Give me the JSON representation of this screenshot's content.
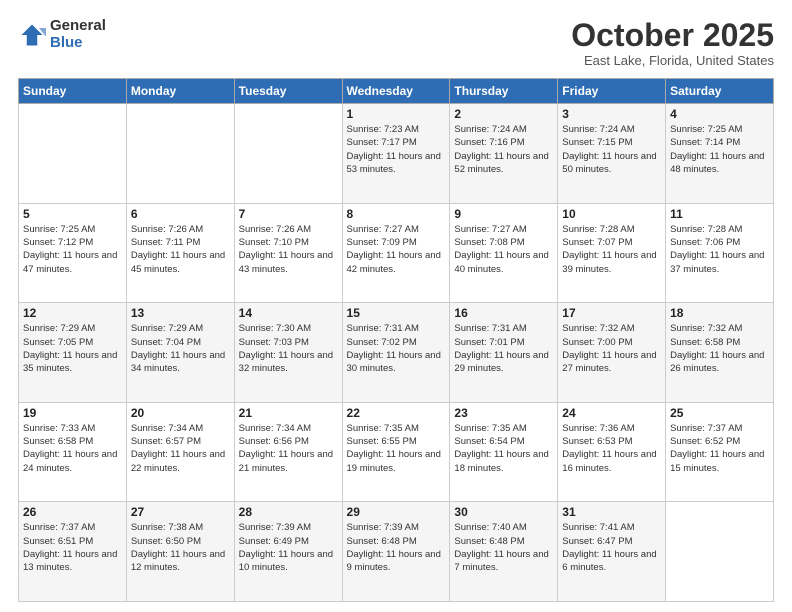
{
  "logo": {
    "general": "General",
    "blue": "Blue"
  },
  "title": "October 2025",
  "location": "East Lake, Florida, United States",
  "days_of_week": [
    "Sunday",
    "Monday",
    "Tuesday",
    "Wednesday",
    "Thursday",
    "Friday",
    "Saturday"
  ],
  "weeks": [
    [
      {
        "day": "",
        "info": ""
      },
      {
        "day": "",
        "info": ""
      },
      {
        "day": "",
        "info": ""
      },
      {
        "day": "1",
        "info": "Sunrise: 7:23 AM\nSunset: 7:17 PM\nDaylight: 11 hours and 53 minutes."
      },
      {
        "day": "2",
        "info": "Sunrise: 7:24 AM\nSunset: 7:16 PM\nDaylight: 11 hours and 52 minutes."
      },
      {
        "day": "3",
        "info": "Sunrise: 7:24 AM\nSunset: 7:15 PM\nDaylight: 11 hours and 50 minutes."
      },
      {
        "day": "4",
        "info": "Sunrise: 7:25 AM\nSunset: 7:14 PM\nDaylight: 11 hours and 48 minutes."
      }
    ],
    [
      {
        "day": "5",
        "info": "Sunrise: 7:25 AM\nSunset: 7:12 PM\nDaylight: 11 hours and 47 minutes."
      },
      {
        "day": "6",
        "info": "Sunrise: 7:26 AM\nSunset: 7:11 PM\nDaylight: 11 hours and 45 minutes."
      },
      {
        "day": "7",
        "info": "Sunrise: 7:26 AM\nSunset: 7:10 PM\nDaylight: 11 hours and 43 minutes."
      },
      {
        "day": "8",
        "info": "Sunrise: 7:27 AM\nSunset: 7:09 PM\nDaylight: 11 hours and 42 minutes."
      },
      {
        "day": "9",
        "info": "Sunrise: 7:27 AM\nSunset: 7:08 PM\nDaylight: 11 hours and 40 minutes."
      },
      {
        "day": "10",
        "info": "Sunrise: 7:28 AM\nSunset: 7:07 PM\nDaylight: 11 hours and 39 minutes."
      },
      {
        "day": "11",
        "info": "Sunrise: 7:28 AM\nSunset: 7:06 PM\nDaylight: 11 hours and 37 minutes."
      }
    ],
    [
      {
        "day": "12",
        "info": "Sunrise: 7:29 AM\nSunset: 7:05 PM\nDaylight: 11 hours and 35 minutes."
      },
      {
        "day": "13",
        "info": "Sunrise: 7:29 AM\nSunset: 7:04 PM\nDaylight: 11 hours and 34 minutes."
      },
      {
        "day": "14",
        "info": "Sunrise: 7:30 AM\nSunset: 7:03 PM\nDaylight: 11 hours and 32 minutes."
      },
      {
        "day": "15",
        "info": "Sunrise: 7:31 AM\nSunset: 7:02 PM\nDaylight: 11 hours and 30 minutes."
      },
      {
        "day": "16",
        "info": "Sunrise: 7:31 AM\nSunset: 7:01 PM\nDaylight: 11 hours and 29 minutes."
      },
      {
        "day": "17",
        "info": "Sunrise: 7:32 AM\nSunset: 7:00 PM\nDaylight: 11 hours and 27 minutes."
      },
      {
        "day": "18",
        "info": "Sunrise: 7:32 AM\nSunset: 6:58 PM\nDaylight: 11 hours and 26 minutes."
      }
    ],
    [
      {
        "day": "19",
        "info": "Sunrise: 7:33 AM\nSunset: 6:58 PM\nDaylight: 11 hours and 24 minutes."
      },
      {
        "day": "20",
        "info": "Sunrise: 7:34 AM\nSunset: 6:57 PM\nDaylight: 11 hours and 22 minutes."
      },
      {
        "day": "21",
        "info": "Sunrise: 7:34 AM\nSunset: 6:56 PM\nDaylight: 11 hours and 21 minutes."
      },
      {
        "day": "22",
        "info": "Sunrise: 7:35 AM\nSunset: 6:55 PM\nDaylight: 11 hours and 19 minutes."
      },
      {
        "day": "23",
        "info": "Sunrise: 7:35 AM\nSunset: 6:54 PM\nDaylight: 11 hours and 18 minutes."
      },
      {
        "day": "24",
        "info": "Sunrise: 7:36 AM\nSunset: 6:53 PM\nDaylight: 11 hours and 16 minutes."
      },
      {
        "day": "25",
        "info": "Sunrise: 7:37 AM\nSunset: 6:52 PM\nDaylight: 11 hours and 15 minutes."
      }
    ],
    [
      {
        "day": "26",
        "info": "Sunrise: 7:37 AM\nSunset: 6:51 PM\nDaylight: 11 hours and 13 minutes."
      },
      {
        "day": "27",
        "info": "Sunrise: 7:38 AM\nSunset: 6:50 PM\nDaylight: 11 hours and 12 minutes."
      },
      {
        "day": "28",
        "info": "Sunrise: 7:39 AM\nSunset: 6:49 PM\nDaylight: 11 hours and 10 minutes."
      },
      {
        "day": "29",
        "info": "Sunrise: 7:39 AM\nSunset: 6:48 PM\nDaylight: 11 hours and 9 minutes."
      },
      {
        "day": "30",
        "info": "Sunrise: 7:40 AM\nSunset: 6:48 PM\nDaylight: 11 hours and 7 minutes."
      },
      {
        "day": "31",
        "info": "Sunrise: 7:41 AM\nSunset: 6:47 PM\nDaylight: 11 hours and 6 minutes."
      },
      {
        "day": "",
        "info": ""
      }
    ]
  ]
}
